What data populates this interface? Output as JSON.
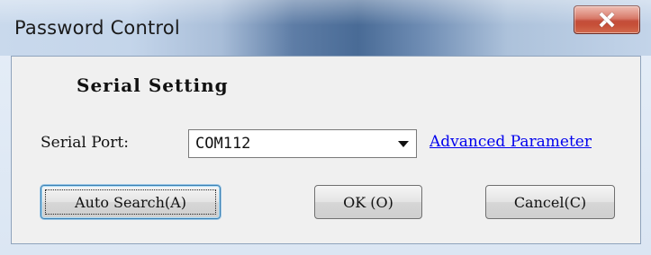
{
  "window": {
    "title": "Password Control",
    "close_icon": "close-icon"
  },
  "serial": {
    "section_title": "Serial Setting",
    "port_label": "Serial Port:",
    "port_value": "COM112",
    "advanced_link": "Advanced Parameter"
  },
  "buttons": {
    "auto_search": "Auto Search(A)",
    "ok": "OK (O)",
    "cancel": "Cancel(C)"
  }
}
